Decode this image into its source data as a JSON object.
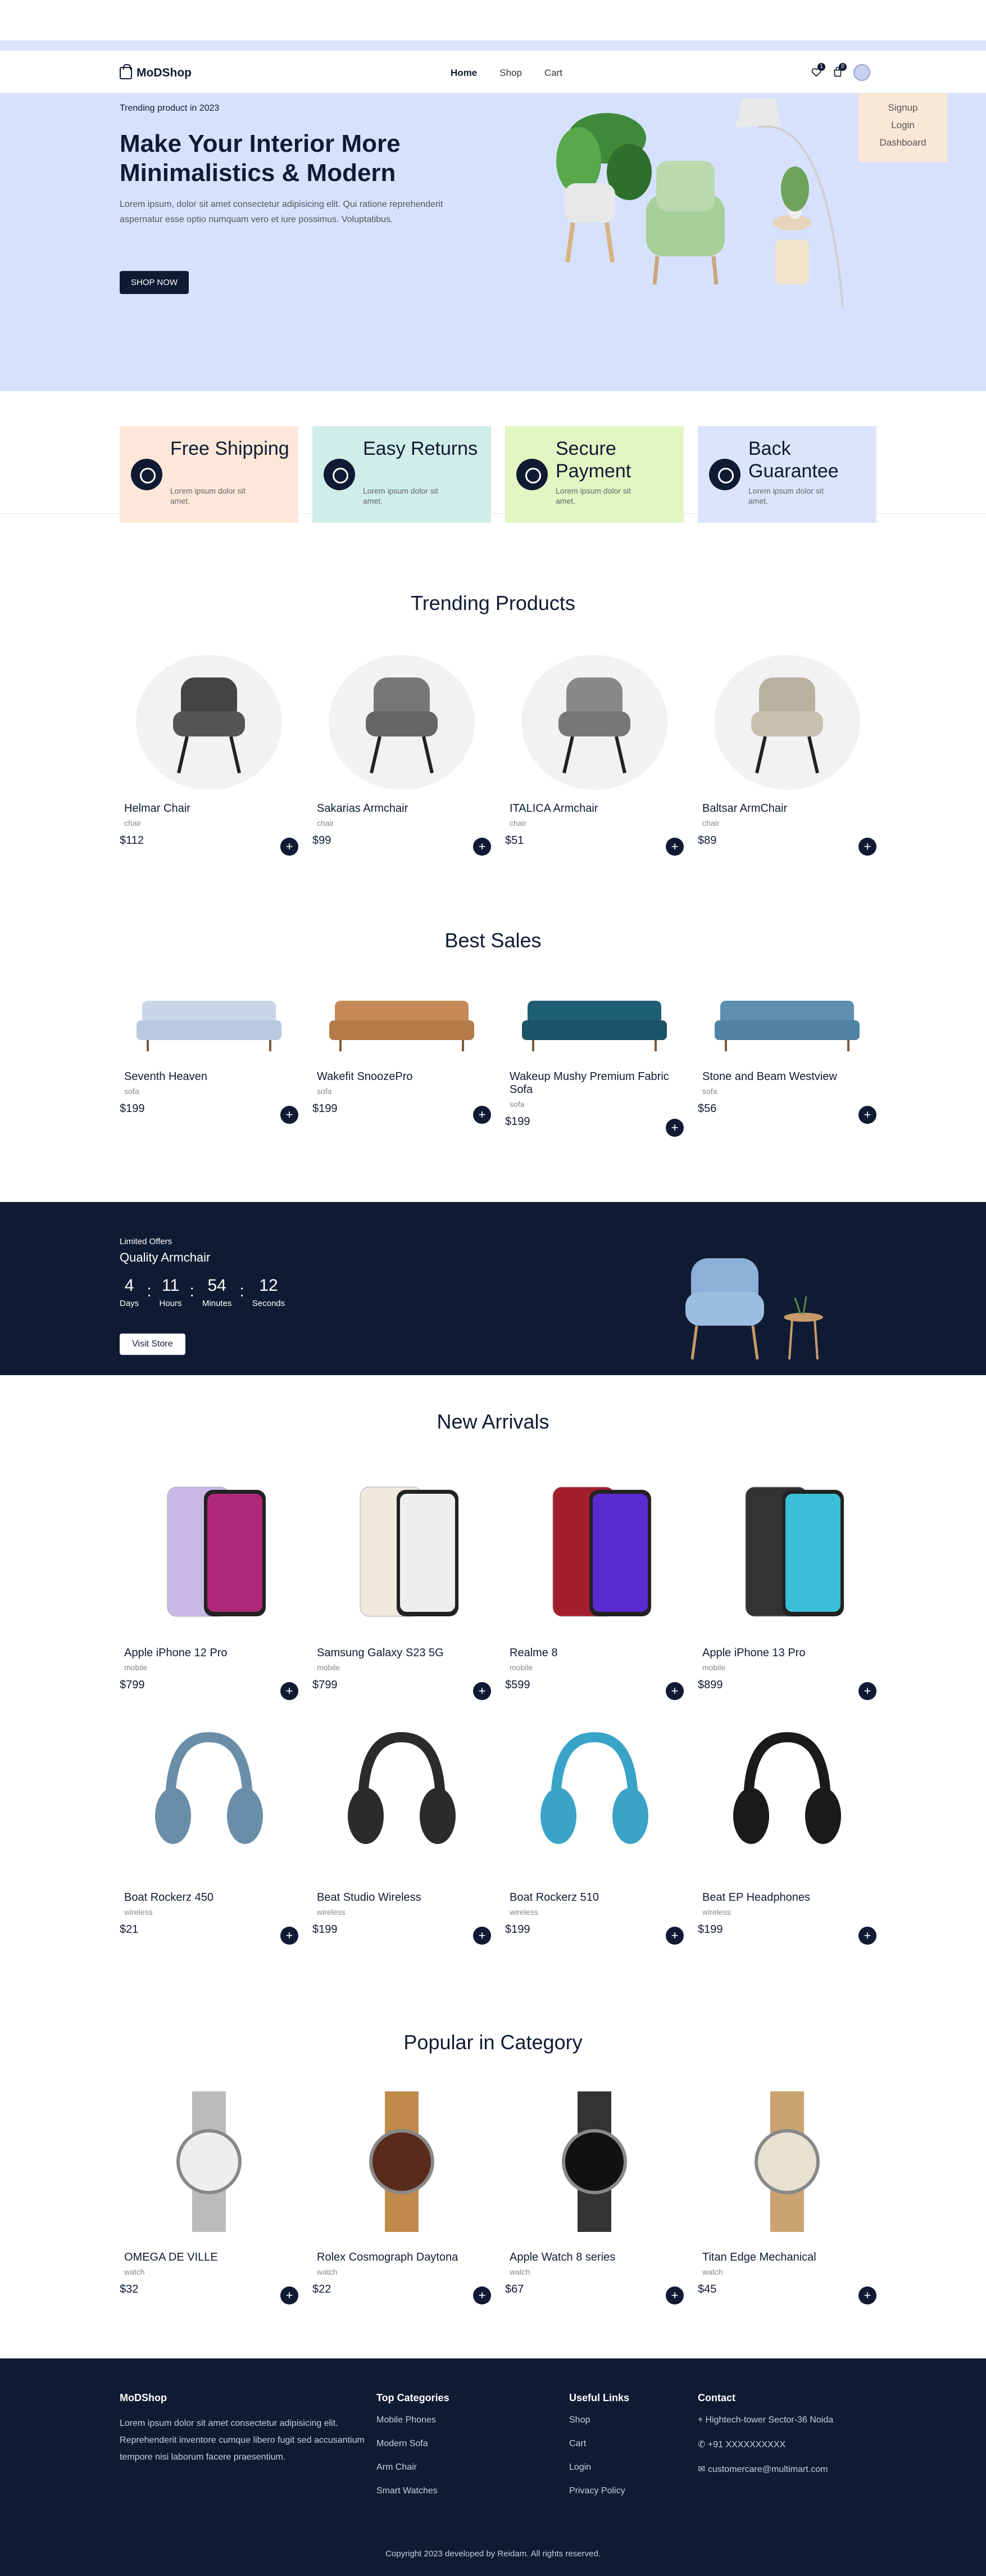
{
  "brand": "MoDShop",
  "nav": {
    "links": [
      "Home",
      "Shop",
      "Cart"
    ],
    "wishlist_count": "1",
    "cart_count": "0"
  },
  "dropdown": [
    "Signup",
    "Login",
    "Dashboard"
  ],
  "hero": {
    "kicker": "Trending product in 2023",
    "title": "Make Your Interior More Minimalistics & Modern",
    "text": "Lorem ipsum, dolor sit amet consectetur adipisicing elit. Qui ratione reprehenderit aspernatur esse optio numquam vero et iure possimus. Voluptatibus.",
    "button": "SHOP NOW"
  },
  "features": [
    {
      "title": "Free Shipping",
      "text": "Lorem ipsum dolor sit amet.",
      "color": "#fde7d9"
    },
    {
      "title": "Easy Returns",
      "text": "Lorem ipsum dolor sit amet.",
      "color": "#cfeee8"
    },
    {
      "title": "Secure Payment",
      "text": "Lorem ipsum dolor sit amet.",
      "color": "#e2f5c2"
    },
    {
      "title": "Back Guarantee",
      "text": "Lorem ipsum dolor sit amet.",
      "color": "#dbe4fb"
    }
  ],
  "trending": {
    "title": "Trending Products",
    "items": [
      {
        "name": "Helmar Chair",
        "cat": "chair",
        "price": "$112"
      },
      {
        "name": "Sakarias Armchair",
        "cat": "chair",
        "price": "$99"
      },
      {
        "name": "ITALICA Armchair",
        "cat": "chair",
        "price": "$51"
      },
      {
        "name": "Baltsar ArmChair",
        "cat": "chair",
        "price": "$89"
      }
    ]
  },
  "bestsales": {
    "title": "Best Sales",
    "items": [
      {
        "name": "Seventh Heaven",
        "cat": "sofa",
        "price": "$199"
      },
      {
        "name": "Wakefit SnoozePro",
        "cat": "sofa",
        "price": "$199"
      },
      {
        "name": "Wakeup Mushy Premium Fabric Sofa",
        "cat": "sofa",
        "price": "$199"
      },
      {
        "name": "Stone and Beam Westview",
        "cat": "sofa",
        "price": "$56"
      }
    ]
  },
  "offer": {
    "label": "Limited Offers",
    "title": "Quality Armchair",
    "days": "4",
    "hours": "11",
    "minutes": "54",
    "seconds": "12",
    "days_l": "Days",
    "hours_l": "Hours",
    "minutes_l": "Minutes",
    "seconds_l": "Seconds",
    "button": "Visit Store"
  },
  "arrivals": {
    "title": "New Arrivals",
    "items": [
      {
        "name": "Apple iPhone 12 Pro",
        "cat": "mobile",
        "price": "$799"
      },
      {
        "name": "Samsung Galaxy S23 5G",
        "cat": "mobile",
        "price": "$799"
      },
      {
        "name": "Realme 8",
        "cat": "mobile",
        "price": "$599"
      },
      {
        "name": "Apple iPhone 13 Pro",
        "cat": "mobile",
        "price": "$899"
      },
      {
        "name": "Boat Rockerz 450",
        "cat": "wireless",
        "price": "$21"
      },
      {
        "name": "Beat Studio Wireless",
        "cat": "wireless",
        "price": "$199"
      },
      {
        "name": "Boat Rockerz 510",
        "cat": "wireless",
        "price": "$199"
      },
      {
        "name": "Beat EP Headphones",
        "cat": "wireless",
        "price": "$199"
      }
    ]
  },
  "popular": {
    "title": "Popular in Category",
    "items": [
      {
        "name": "OMEGA DE VILLE",
        "cat": "watch",
        "price": "$32"
      },
      {
        "name": "Rolex Cosmograph Daytona",
        "cat": "watch",
        "price": "$22"
      },
      {
        "name": "Apple Watch 8 series",
        "cat": "watch",
        "price": "$67"
      },
      {
        "name": "Titan Edge Mechanical",
        "cat": "watch",
        "price": "$45"
      }
    ]
  },
  "footer": {
    "brand": "MoDShop",
    "about": "Lorem ipsum dolor sit amet consectetur adipisicing elit. Reprehenderit inventore cumque libero fugit sed accusantium tempore nisi laborum facere praesentium.",
    "cat_title": "Top Categories",
    "cats": [
      "Mobile Phones",
      "Modern Sofa",
      "Arm Chair",
      "Smart Watches"
    ],
    "links_title": "Useful Links",
    "links": [
      "Shop",
      "Cart",
      "Login",
      "Privacy Policy"
    ],
    "contact_title": "Contact",
    "address": "Hightech-tower Sector-36 Noida",
    "phone": "+91 XXXXXXXXXX",
    "email": "customercare@multimart.com",
    "copyright": "Copyright 2023 developed by Reidam. All rights reserved."
  },
  "colors": {
    "accent": "#0f1b33",
    "hero_bg": "#d6e2fd"
  }
}
